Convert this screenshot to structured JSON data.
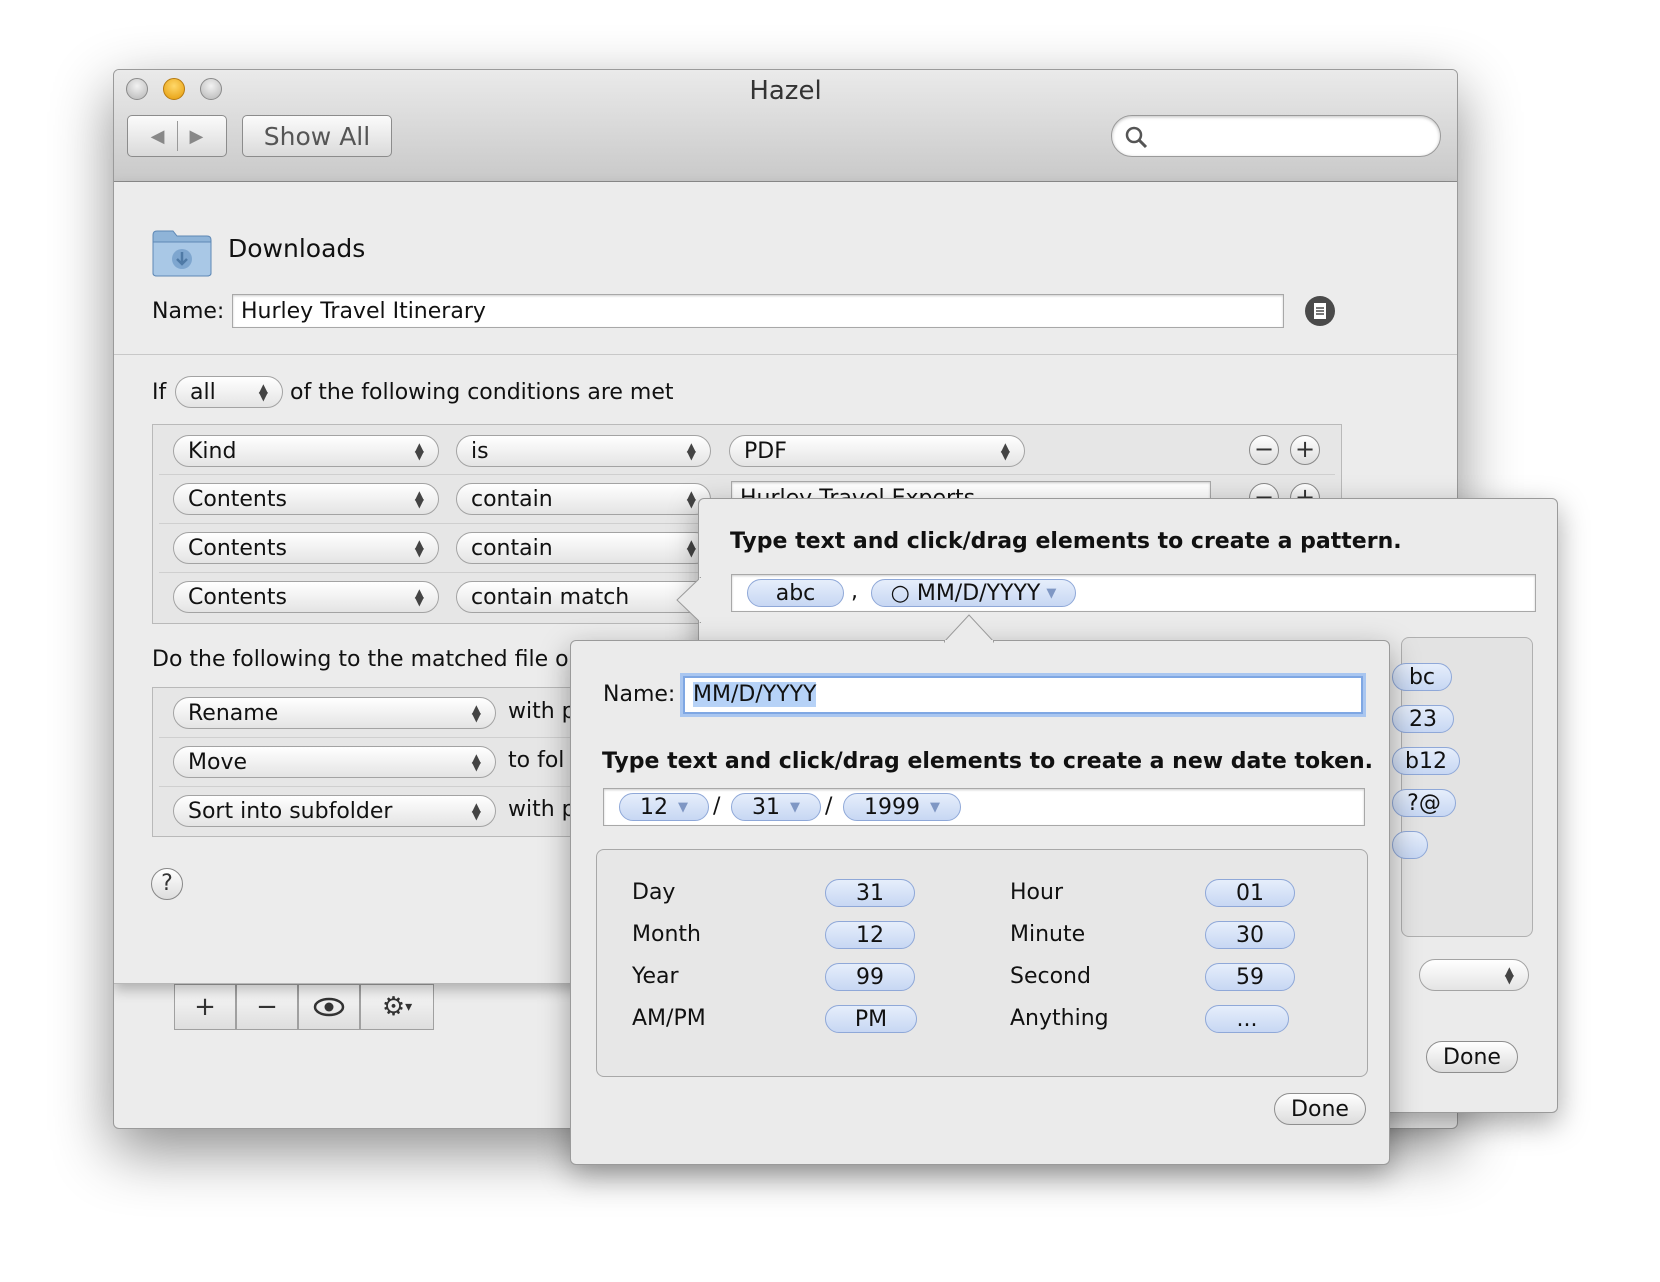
{
  "window": {
    "title": "Hazel",
    "show_all": "Show All",
    "search_placeholder": ""
  },
  "rule": {
    "folder": "Downloads",
    "name_label": "Name:",
    "name_value": "Hurley Travel Itinerary",
    "if_label": "If",
    "match_mode": "all",
    "conditions_suffix": "of the following conditions are met",
    "conditions": [
      {
        "attribute": "Kind",
        "operator": "is",
        "value": "PDF"
      },
      {
        "attribute": "Contents",
        "operator": "contain",
        "value": "Hurley Travel Experts"
      },
      {
        "attribute": "Contents",
        "operator": "contain",
        "value": ""
      },
      {
        "attribute": "Contents",
        "operator": "contain match",
        "value": ""
      }
    ],
    "actions_header": "Do the following to the matched file or fo",
    "actions": [
      {
        "action": "Rename",
        "suffix": "with p"
      },
      {
        "action": "Move",
        "suffix": "to fol"
      },
      {
        "action": "Sort into subfolder",
        "suffix": "with p"
      }
    ],
    "help": "?"
  },
  "bottom_bar": {
    "add": "+",
    "remove": "−"
  },
  "pattern_popover": {
    "header": "Type text and click/drag elements to create a pattern.",
    "tokens": [
      "abc",
      ",",
      "○ MM/D/YYYY"
    ],
    "side_tokens": [
      "bc",
      "23",
      "b12",
      "?@",
      ""
    ],
    "done": "Done"
  },
  "date_popover": {
    "name_label": "Name:",
    "name_value": "MM/D/YYYY",
    "header": "Type text and click/drag elements to create a new date token.",
    "tokens": [
      "12",
      "/",
      "31",
      "/",
      "1999"
    ],
    "elements_left": [
      {
        "label": "Day",
        "token": "31"
      },
      {
        "label": "Month",
        "token": "12"
      },
      {
        "label": "Year",
        "token": "99"
      },
      {
        "label": "AM/PM",
        "token": "PM"
      }
    ],
    "elements_right": [
      {
        "label": "Hour",
        "token": "01"
      },
      {
        "label": "Minute",
        "token": "30"
      },
      {
        "label": "Second",
        "token": "59"
      },
      {
        "label": "Anything",
        "token": "..."
      }
    ],
    "done": "Done"
  }
}
